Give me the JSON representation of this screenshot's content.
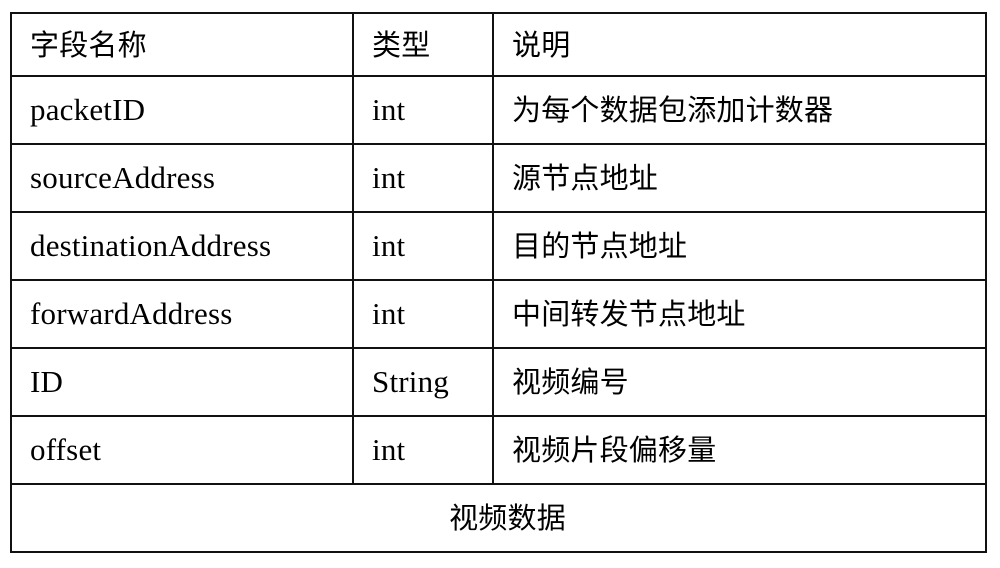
{
  "document": {
    "type": "table",
    "caption": "视频数据",
    "background_color": "#ffffff",
    "text_color": "#000000",
    "border_color": "#111111"
  },
  "table": {
    "headers": {
      "field": "字段名称",
      "type": "类型",
      "description": "说明"
    },
    "rows": [
      {
        "field": "packetID",
        "type": "int",
        "description": "为每个数据包添加计数器"
      },
      {
        "field": "sourceAddress",
        "type": "int",
        "description": "源节点地址"
      },
      {
        "field": "destinationAddress",
        "type": "int",
        "description": "目的节点地址"
      },
      {
        "field": "forwardAddress",
        "type": "int",
        "description": "中间转发节点地址"
      },
      {
        "field": "ID",
        "type": "String",
        "description": "视频编号"
      },
      {
        "field": "offset",
        "type": "int",
        "description": "视频片段偏移量"
      }
    ],
    "footer_caption": "视频数据"
  }
}
